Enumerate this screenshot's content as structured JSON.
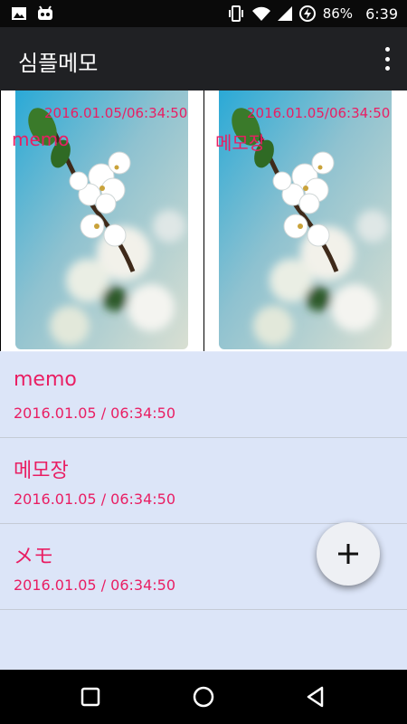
{
  "status_bar": {
    "battery": "86%",
    "time": "6:39",
    "icons": [
      "image-icon",
      "android-icon",
      "vibrate-icon",
      "wifi-icon",
      "signal-icon",
      "battery-charging-icon"
    ]
  },
  "app_bar": {
    "title": "심플메모",
    "menu_icon": "more-vert-icon"
  },
  "gallery": [
    {
      "title": "memo",
      "date": "2016.01.05/06:34:50"
    },
    {
      "title": "메모장",
      "date": "2016.01.05/06:34:50"
    }
  ],
  "memos": [
    {
      "title": "memo",
      "date": "2016.01.05 / 06:34:50"
    },
    {
      "title": "메모장",
      "date": "2016.01.05 / 06:34:50"
    },
    {
      "title": "メモ",
      "date": "2016.01.05 / 06:34:50"
    }
  ],
  "fab": {
    "icon": "plus-icon"
  },
  "nav_bar": {
    "icons": [
      "recents-icon",
      "home-icon",
      "back-icon"
    ]
  },
  "colors": {
    "accent": "#e91e63",
    "app_bar": "#202124",
    "list_bg": "#dce5f8"
  }
}
